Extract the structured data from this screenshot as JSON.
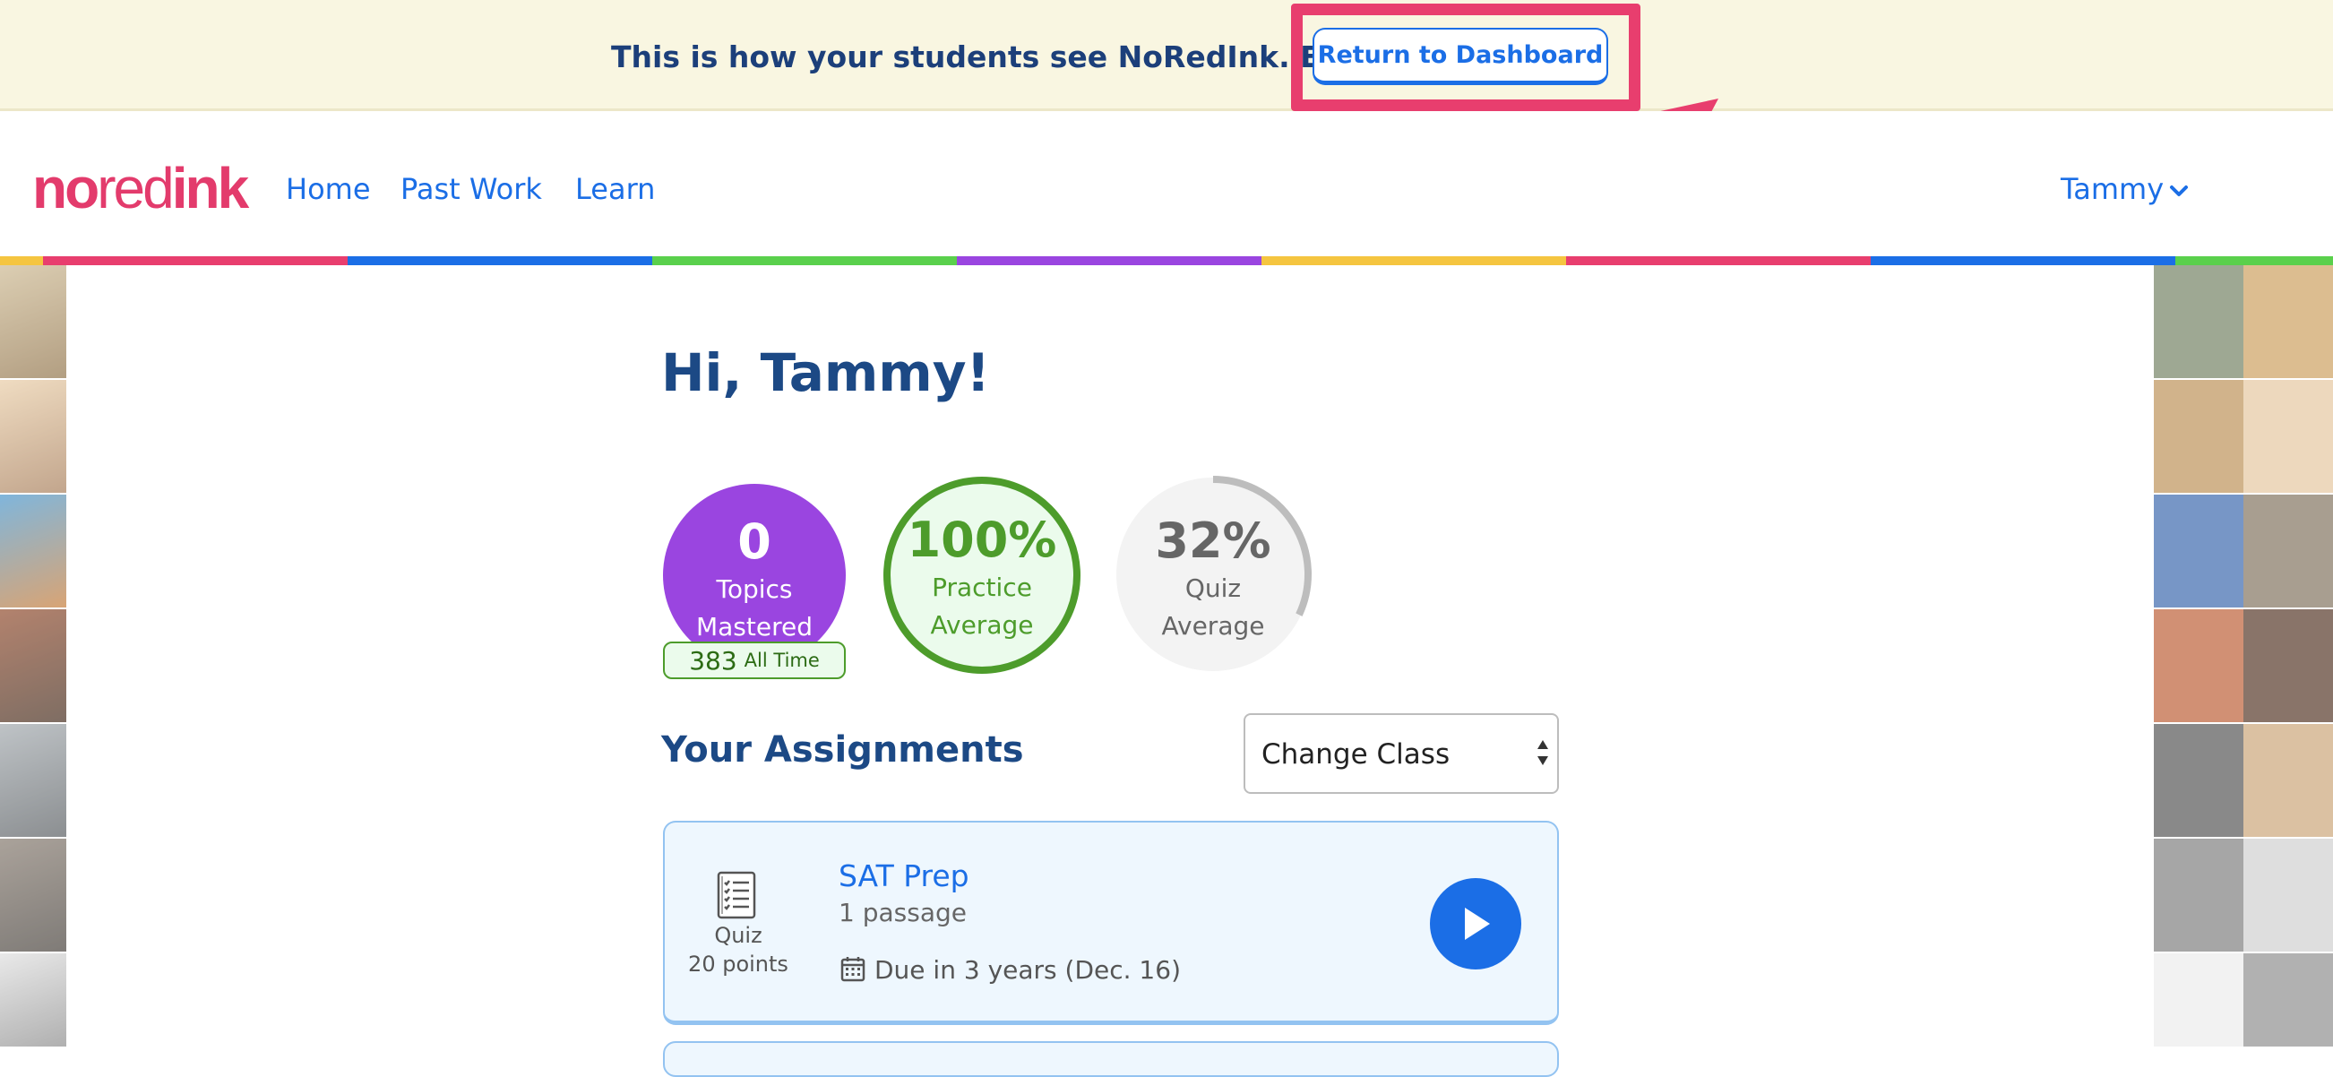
{
  "banner": {
    "message": "This is how your students see NoRedInk. Explore!",
    "return_button": "Return to Dashboard",
    "highlight_color": "#e83e6e"
  },
  "header": {
    "logo": {
      "part1": "no",
      "part2": "red",
      "part3": "ink"
    },
    "nav": [
      {
        "label": "Home"
      },
      {
        "label": "Past Work"
      },
      {
        "label": "Learn"
      }
    ],
    "user": {
      "name": "Tammy",
      "icon": "chevron-down-icon"
    },
    "stripe_colors": [
      "#e83e6e",
      "#1b6ee6",
      "#5ad04c",
      "#9a45e0",
      "#f5c540"
    ]
  },
  "greeting": "Hi, Tammy!",
  "stats": {
    "topics": {
      "value": "0",
      "label_1": "Topics",
      "label_2": "Mastered",
      "all_time_value": "383",
      "all_time_label": "All Time",
      "color": "#9a45e0"
    },
    "practice": {
      "value": "100%",
      "label_1": "Practice",
      "label_2": "Average",
      "color": "#4d9c2b"
    },
    "quiz": {
      "value": "32%",
      "label_1": "Quiz",
      "label_2": "Average",
      "progress": 0.32
    }
  },
  "assignments": {
    "title": "Your Assignments",
    "class_select": {
      "selected": "Change Class"
    },
    "items": [
      {
        "type": "Quiz",
        "points": "20 points",
        "icon": "quiz-checklist-icon",
        "title": "SAT Prep",
        "subtitle": "1 passage",
        "due": "Due in 3 years (Dec. 16)",
        "action_icon": "play-icon"
      }
    ]
  }
}
